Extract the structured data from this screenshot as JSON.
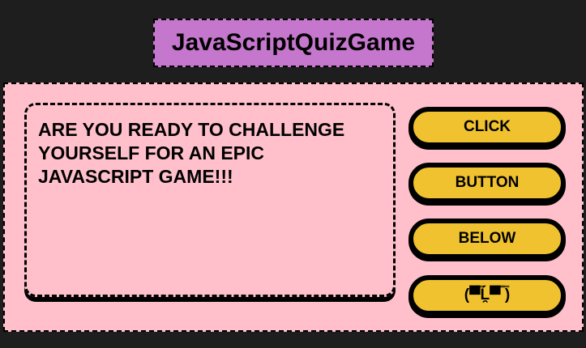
{
  "header": {
    "title": "JavaScriptQuizGame"
  },
  "quiz": {
    "question": "ARE YOU READY TO CHALLENGE YOURSELF FOR AN EPIC JAVASCRIPT GAME!!!",
    "choices": [
      {
        "label": "CLICK"
      },
      {
        "label": "BUTTON"
      },
      {
        "label": "BELOW"
      },
      {
        "label": "(▀̿Ĺ̯▀̿ ̿)"
      }
    ]
  },
  "colors": {
    "background": "#1e1e1e",
    "title_bg": "#c576cd",
    "panel_bg": "#ffc0cb",
    "button_bg": "#f0c230",
    "text": "#000000"
  }
}
